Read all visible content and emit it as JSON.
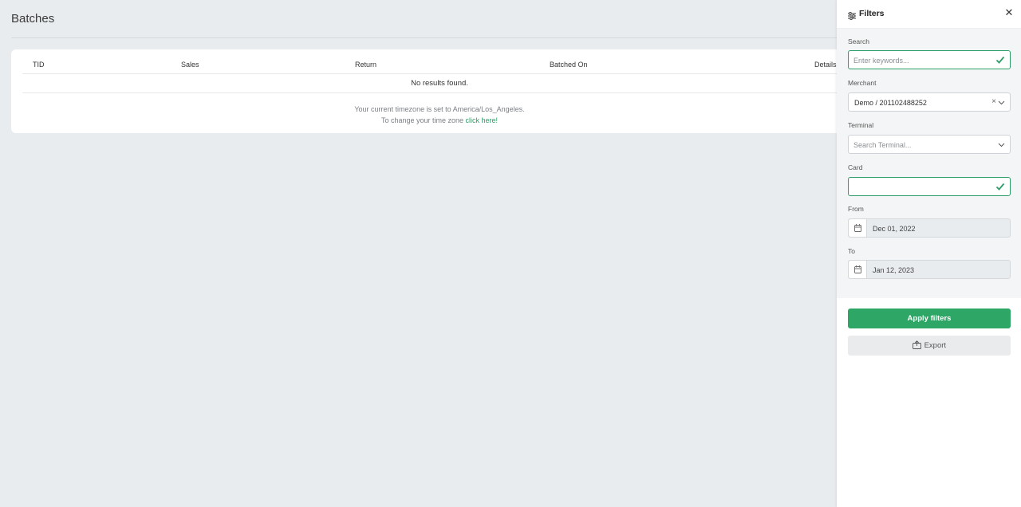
{
  "page": {
    "title": "Batches"
  },
  "table": {
    "columns": [
      "TID",
      "Sales",
      "Return",
      "Batched On",
      "Details"
    ],
    "empty_text": "No results found.",
    "timezone_line": "Your current timezone is set to America/Los_Angeles.",
    "change_prefix": "To change your time zone ",
    "change_link": "click here!"
  },
  "filters": {
    "title": "Filters",
    "close_icon": "close-icon",
    "search": {
      "label": "Search",
      "placeholder": "Enter keywords..."
    },
    "merchant": {
      "label": "Merchant",
      "value": "Demo / 201102488252"
    },
    "terminal": {
      "label": "Terminal",
      "placeholder": "Search Terminal..."
    },
    "card": {
      "label": "Card",
      "value": ""
    },
    "from": {
      "label": "From",
      "value": "Dec 01, 2022"
    },
    "to": {
      "label": "To",
      "value": "Jan 12, 2023"
    },
    "apply_label": "Apply filters",
    "export_label": "Export"
  },
  "colors": {
    "accent": "#2ea766",
    "background": "#e9ecef"
  }
}
